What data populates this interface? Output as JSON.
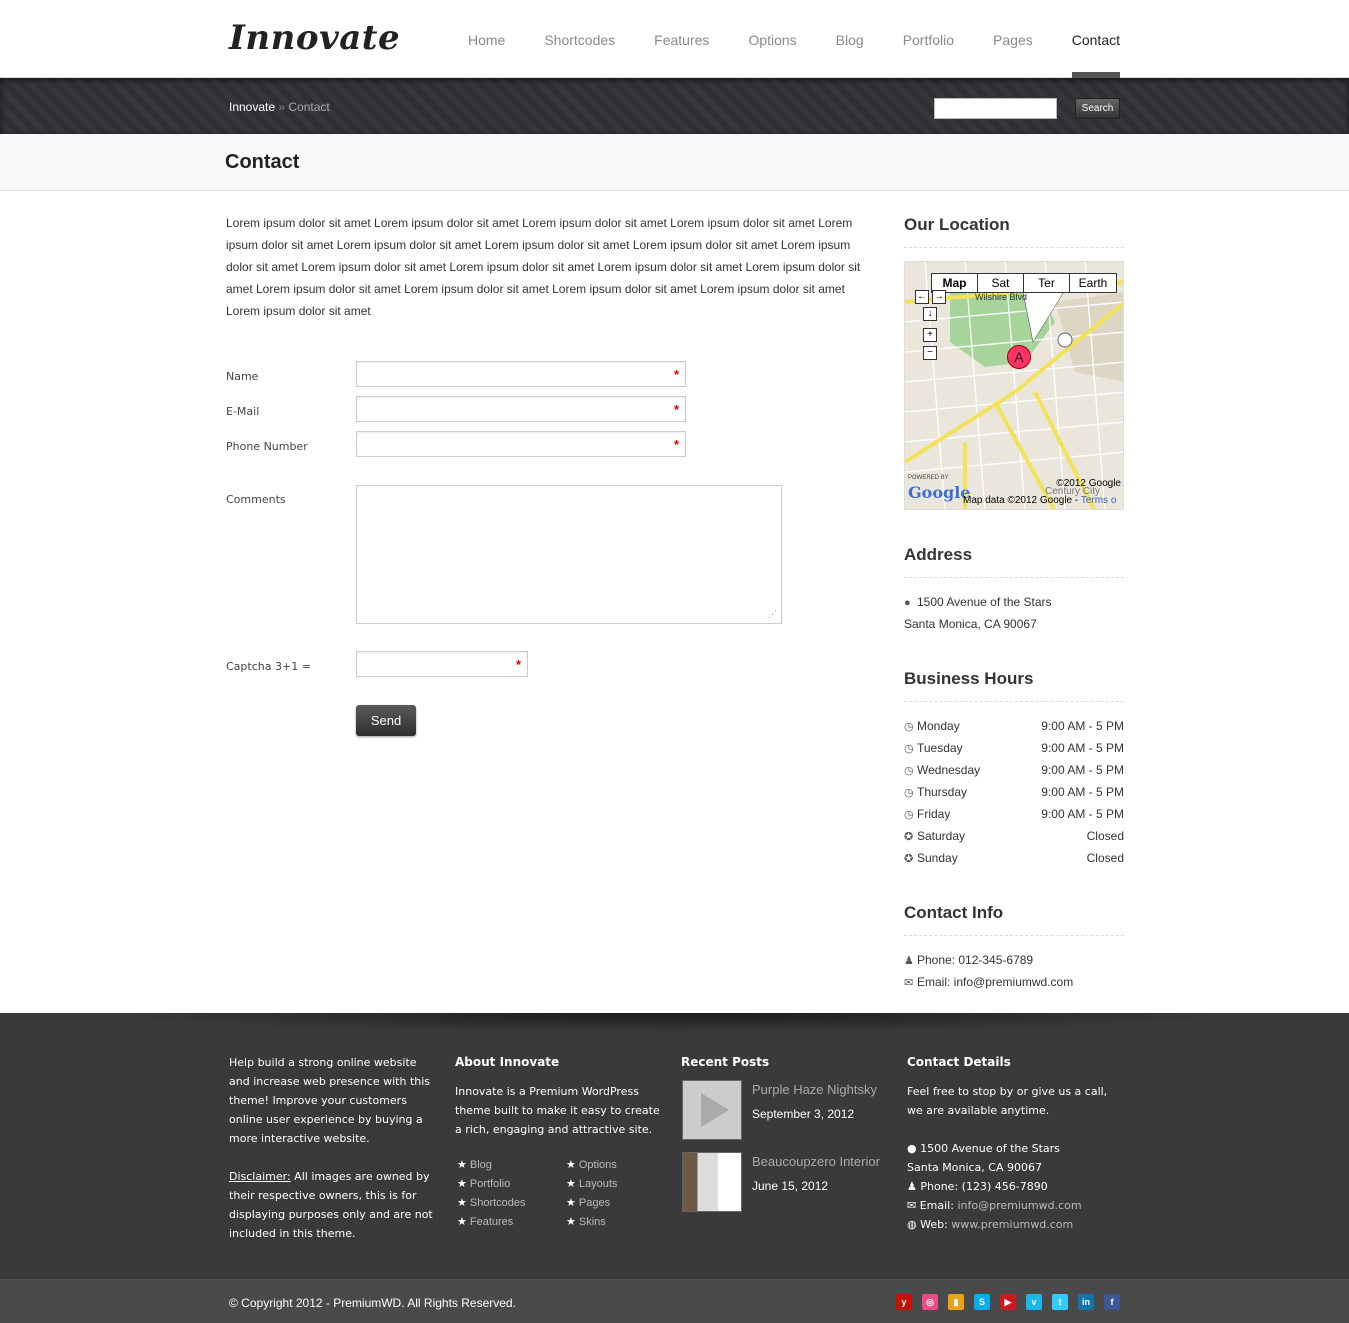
{
  "brand": {
    "logo": "Innovate"
  },
  "nav": {
    "items": [
      "Home",
      "Shortcodes",
      "Features",
      "Options",
      "Blog",
      "Portfolio",
      "Pages",
      "Contact"
    ],
    "active": "Contact"
  },
  "breadcrumb": {
    "home": "Innovate",
    "sep": " » ",
    "current": "Contact"
  },
  "search": {
    "button": "Search",
    "value": ""
  },
  "page": {
    "title": "Contact"
  },
  "intro": "Lorem ipsum dolor sit amet Lorem ipsum dolor sit amet Lorem ipsum dolor sit amet Lorem ipsum dolor sit amet Lorem ipsum dolor sit amet Lorem ipsum dolor sit amet Lorem ipsum dolor sit amet Lorem ipsum dolor sit amet Lorem ipsum dolor sit amet Lorem ipsum dolor sit amet Lorem ipsum dolor sit amet Lorem ipsum dolor sit amet Lorem ipsum dolor sit amet Lorem ipsum dolor sit amet Lorem ipsum dolor sit amet Lorem ipsum dolor sit amet Lorem ipsum dolor sit amet Lorem ipsum dolor sit amet",
  "form": {
    "name_label": "Name",
    "email_label": "E-Mail",
    "phone_label": "Phone Number",
    "comments_label": "Comments",
    "captcha_label": "Captcha 3+1 =",
    "required_mark": "*",
    "send": "Send"
  },
  "sidebar": {
    "location_title": "Our Location",
    "map": {
      "tabs": [
        "Map",
        "Sat",
        "Ter",
        "Earth"
      ],
      "selected_tab": "Map",
      "marker": "A",
      "road": "Wilshire Blvd",
      "copyright": "©2012 Google",
      "data": "Map data ©2012 Google - ",
      "terms": "Terms o",
      "powered": "POWERED BY",
      "google": "Google",
      "city": "Century City"
    },
    "address_title": "Address",
    "address_line1": "1500 Avenue of the Stars",
    "address_line2": "Santa Monica, CA 90067",
    "hours_title": "Business Hours",
    "hours": [
      {
        "day": "Monday",
        "time": "9:00 AM - 5 PM"
      },
      {
        "day": "Tuesday",
        "time": "9:00 AM - 5 PM"
      },
      {
        "day": "Wednesday",
        "time": "9:00 AM - 5 PM"
      },
      {
        "day": "Thursday",
        "time": "9:00 AM - 5 PM"
      },
      {
        "day": "Friday",
        "time": "9:00 AM - 5 PM"
      },
      {
        "day": "Saturday",
        "time": "Closed"
      },
      {
        "day": "Sunday",
        "time": "Closed"
      }
    ],
    "contact_title": "Contact Info",
    "phone": "Phone: 012-345-6789",
    "email": "Email: info@premiumwd.com"
  },
  "footer": {
    "about_text_1": "Help build a strong online website and increase web presence with this theme! Improve your customers online user experience by buying a more interactive website.",
    "disclaimer_label": "Disclaimer:",
    "disclaimer_text": " All images are owned by their respective owners, this is for displaying purposes only and are not included in this theme.",
    "about_title": "About Innovate",
    "about_desc": "Innovate is a Premium WordPress theme built to make it easy to create a rich, engaging and attractive site.",
    "links_col1": [
      "Blog",
      "Portfolio",
      "Shortcodes",
      "Features"
    ],
    "links_col2": [
      "Options",
      "Layouts",
      "Pages",
      "Skins"
    ],
    "recent_title": "Recent Posts",
    "posts": [
      {
        "title": "Purple Haze Nightsky",
        "date": "September 3, 2012"
      },
      {
        "title": "Beaucoupzero Interior",
        "date": "June 15, 2012"
      }
    ],
    "contact_title": "Contact Details",
    "contact_intro": "Feel free to stop by or give us a call, we are available anytime.",
    "contact_address1": "1500 Avenue of the Stars",
    "contact_address2": "Santa Monica, CA 90067",
    "contact_phone": "Phone: (123) 456-7890",
    "contact_email_label": "Email: ",
    "contact_email": "info@premiumwd.com",
    "contact_web_label": "Web: ",
    "contact_web": "www.premiumwd.com",
    "copyright": "© Copyright 2012 - PremiumWD. All Rights Reserved."
  },
  "social": [
    {
      "icon": "yelp-icon",
      "glyph": "y",
      "color": "#c41200"
    },
    {
      "icon": "dribbble-icon",
      "glyph": "◎",
      "color": "#ea4c89"
    },
    {
      "icon": "flickr-icon",
      "glyph": "▮",
      "color": "#e8a317"
    },
    {
      "icon": "skype-icon",
      "glyph": "S",
      "color": "#00aff0"
    },
    {
      "icon": "youtube-icon",
      "glyph": "▶",
      "color": "#cc181e"
    },
    {
      "icon": "vimeo-icon",
      "glyph": "v",
      "color": "#1ab7ea"
    },
    {
      "icon": "twitter-icon",
      "glyph": "t",
      "color": "#33ccff"
    },
    {
      "icon": "linkedin-icon",
      "glyph": "in",
      "color": "#0e76a8"
    },
    {
      "icon": "facebook-icon",
      "glyph": "f",
      "color": "#3b5998"
    }
  ]
}
